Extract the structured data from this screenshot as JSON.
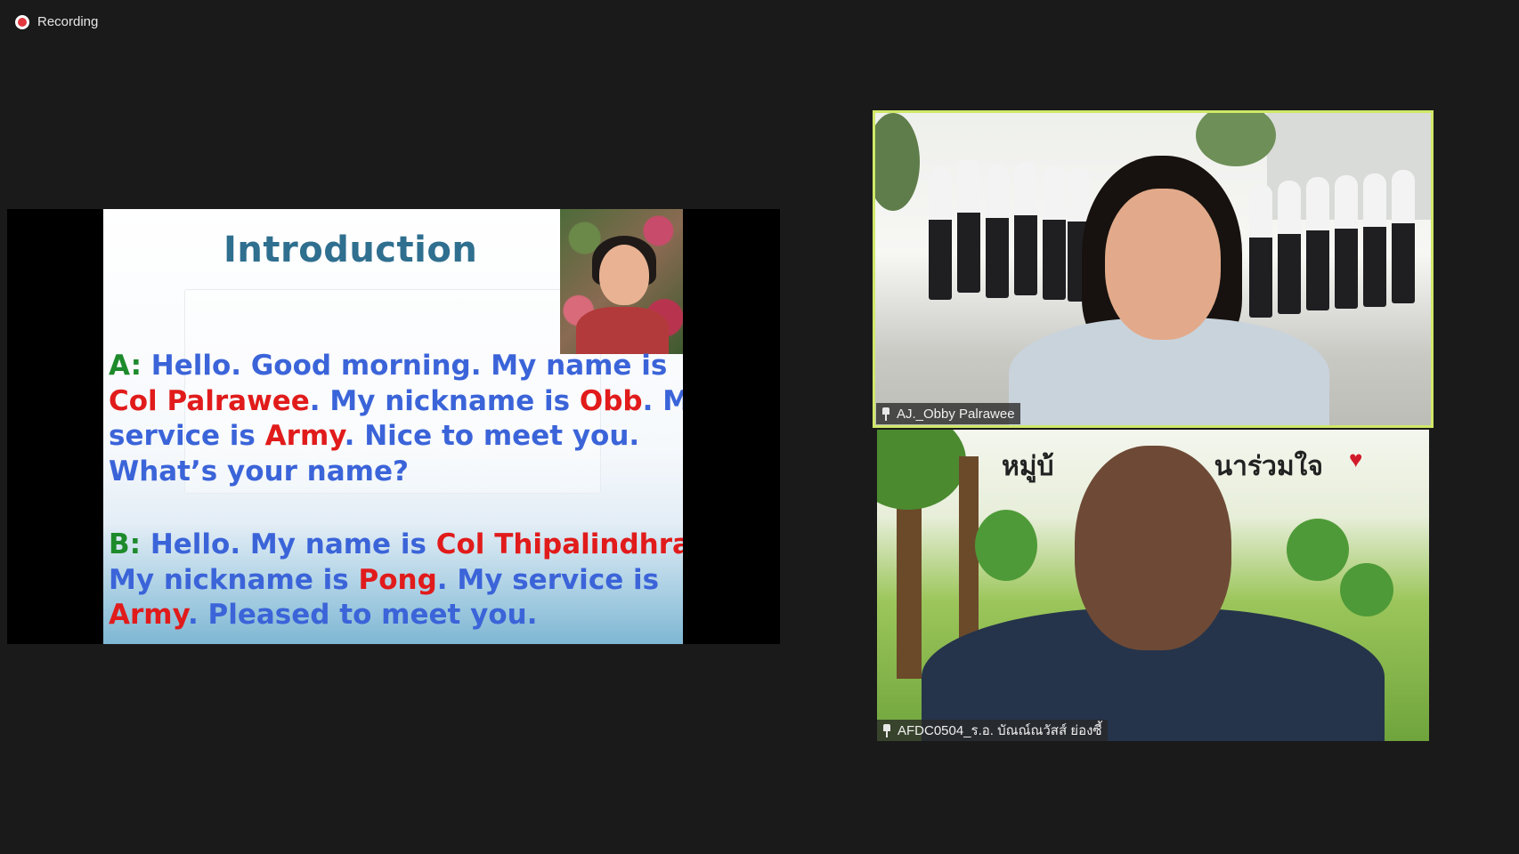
{
  "recording": {
    "label": "Recording"
  },
  "slide": {
    "title": "Introduction",
    "para_a": [
      {
        "t": "A:",
        "c": "sp"
      },
      {
        "t": "  Hello. Good morning. My name is",
        "c": ""
      },
      {
        "br": true
      },
      {
        "t": "Col Palrawee",
        "c": "red"
      },
      {
        "t": ". My nickname is ",
        "c": ""
      },
      {
        "t": "Obb",
        "c": "red"
      },
      {
        "t": ". My",
        "c": ""
      },
      {
        "br": true
      },
      {
        "t": "service is ",
        "c": ""
      },
      {
        "t": "Army",
        "c": "red"
      },
      {
        "t": ". Nice to meet you.",
        "c": ""
      },
      {
        "br": true
      },
      {
        "t": "What’s your name?",
        "c": ""
      }
    ],
    "para_b": [
      {
        "t": "B:",
        "c": "sp"
      },
      {
        "t": "  Hello. My name is ",
        "c": ""
      },
      {
        "t": "Col Thipalindhra",
        "c": "red"
      },
      {
        "t": ".",
        "c": ""
      },
      {
        "br": true
      },
      {
        "t": "My nickname is ",
        "c": ""
      },
      {
        "t": "Pong",
        "c": "red"
      },
      {
        "t": ". My service is",
        "c": ""
      },
      {
        "br": true
      },
      {
        "t": "Army",
        "c": "red"
      },
      {
        "t": ". Pleased to meet you.",
        "c": ""
      }
    ]
  },
  "participants": [
    {
      "name": "AJ._Obby Palrawee",
      "active_speaker": true
    },
    {
      "name": "AFDC0504_ร.อ. บัณณ์ณวัสส์ ย่องซี้",
      "active_speaker": false
    }
  ],
  "tile2_banner": {
    "left": "หมู่บ้",
    "right": "นาร่วมใจ"
  },
  "colors": {
    "background": "#1a1a1a",
    "active_border": "#cfe868",
    "recording_dot": "#e0383e"
  }
}
